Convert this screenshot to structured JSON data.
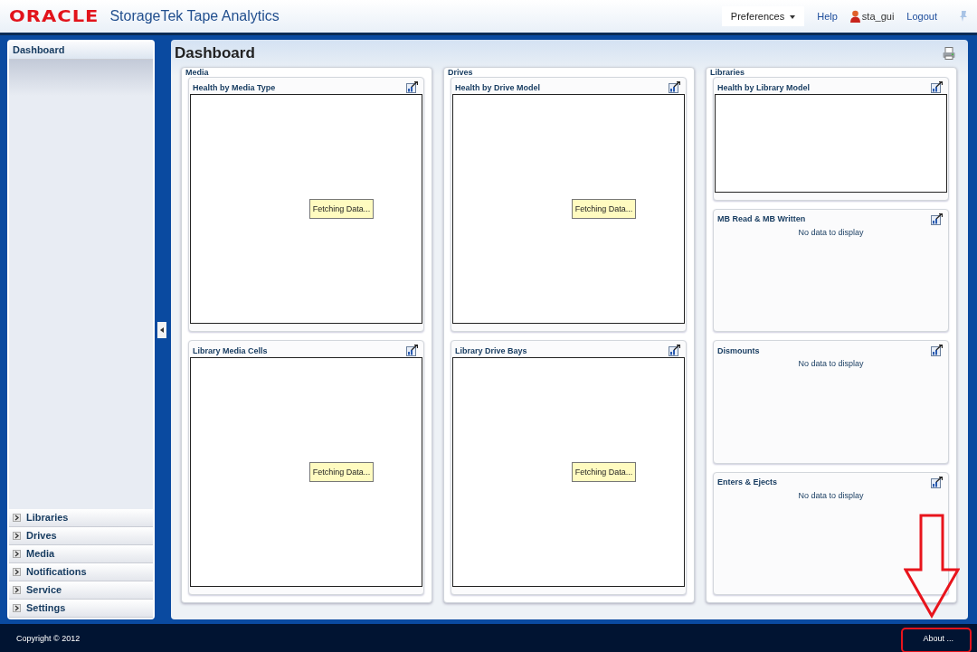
{
  "header": {
    "logo": "ORACLE",
    "product": "StorageTek Tape Analytics",
    "preferences": "Preferences",
    "help": "Help",
    "user": "sta_gui",
    "logout": "Logout"
  },
  "sidebar": {
    "panes": [
      {
        "label": "Dashboard",
        "expanded": true
      },
      {
        "label": "Libraries",
        "expanded": false
      },
      {
        "label": "Drives",
        "expanded": false
      },
      {
        "label": "Media",
        "expanded": false
      },
      {
        "label": "Notifications",
        "expanded": false
      },
      {
        "label": "Service",
        "expanded": false
      },
      {
        "label": "Settings",
        "expanded": false
      }
    ]
  },
  "main": {
    "title": "Dashboard",
    "columns": [
      {
        "title": "Media",
        "widgets": [
          {
            "title": "Health by Media Type",
            "kind": "loading",
            "message": "Fetching Data..."
          },
          {
            "title": "Library Media Cells",
            "kind": "loading",
            "message": "Fetching Data..."
          }
        ]
      },
      {
        "title": "Drives",
        "widgets": [
          {
            "title": "Health by Drive Model",
            "kind": "loading",
            "message": "Fetching Data..."
          },
          {
            "title": "Library Drive Bays",
            "kind": "loading",
            "message": "Fetching Data..."
          }
        ]
      },
      {
        "title": "Libraries",
        "widgets": [
          {
            "title": "Health by Library Model",
            "kind": "frame"
          },
          {
            "title": "MB Read & MB Written",
            "kind": "nodata",
            "message": "No data to display"
          },
          {
            "title": "Dismounts",
            "kind": "nodata",
            "message": "No data to display"
          },
          {
            "title": "Enters & Ejects",
            "kind": "nodata",
            "message": "No data to display"
          }
        ]
      }
    ]
  },
  "footer": {
    "copyright": "Copyright © 2012",
    "about": "About ..."
  }
}
